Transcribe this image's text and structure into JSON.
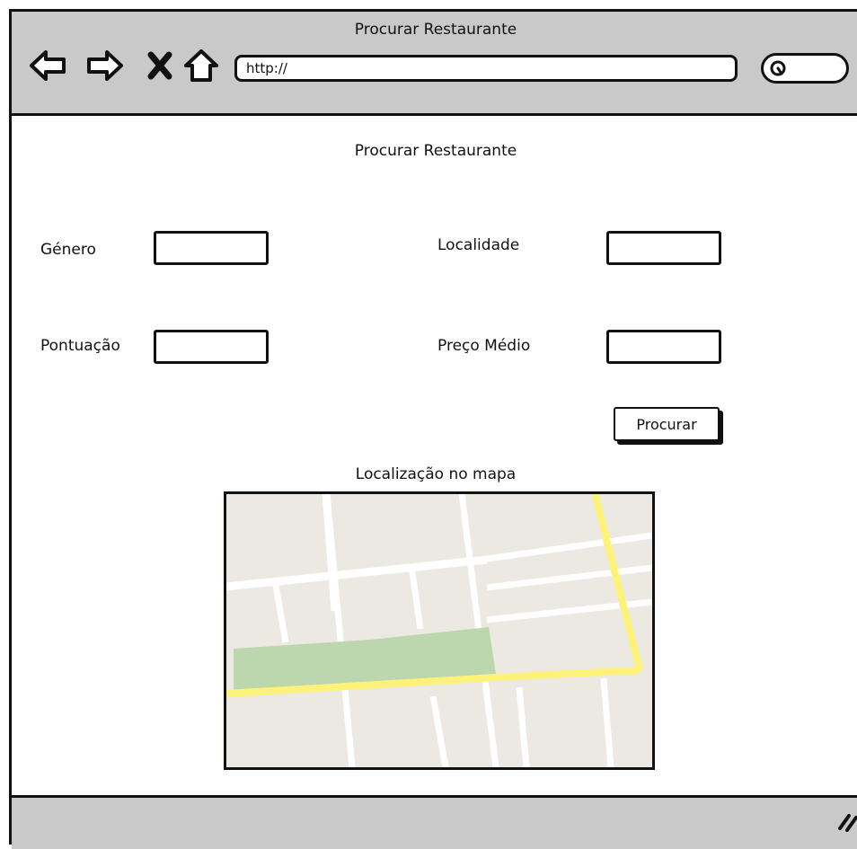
{
  "window": {
    "title": "Procurar Restaurante",
    "url": "http://"
  },
  "page": {
    "title": "Procurar Restaurante"
  },
  "form": {
    "genero_label": "Género",
    "localidade_label": "Localidade",
    "pontuacao_label": "Pontuação",
    "preco_label": "Preço Médio",
    "genero_value": "",
    "localidade_value": "",
    "pontuacao_value": "",
    "preco_value": "",
    "search_label": "Procurar"
  },
  "map": {
    "title": "Localização no mapa"
  },
  "icons": [
    "back-arrow-icon",
    "forward-arrow-icon",
    "close-icon",
    "home-icon",
    "search-icon",
    "resize-grip-icon"
  ],
  "colors": {
    "chrome": "#c9c9c9",
    "map_ground": "#ebe9e2",
    "map_road": "#ffffff",
    "map_highway": "#fff27a",
    "map_park": "#bcd6ad"
  }
}
